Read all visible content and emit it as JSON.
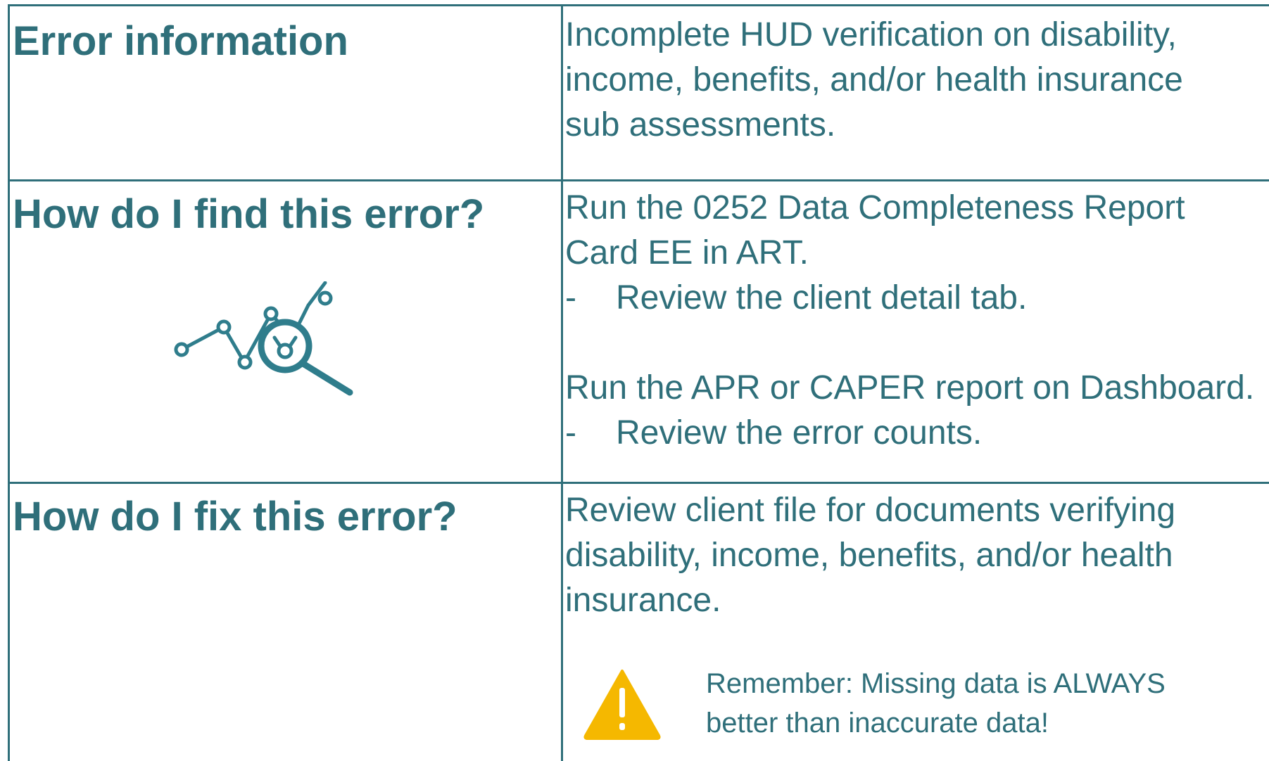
{
  "rows": [
    {
      "heading": "Error information",
      "lines": [
        "Incomplete HUD verification on disability,",
        "income, benefits, and/or health insurance",
        "sub assessments."
      ]
    },
    {
      "heading": "How do I find this error?",
      "lines": [
        "Run the 0252 Data Completeness Report",
        "Card EE in ART."
      ],
      "bullet_1": "Review the client detail tab.",
      "lines_2": [
        "Run the APR or CAPER report on Dashboard."
      ],
      "bullet_2": "Review the error counts.",
      "bullet_marker": "-",
      "icon": "chart-magnifier-icon"
    },
    {
      "heading": "How do I fix this error?",
      "lines": [
        "Review client file for documents verifying",
        "disability, income, benefits, and/or health",
        "insurance."
      ],
      "reminder_lines": [
        "Remember: Missing data is ALWAYS",
        "better than inaccurate data!"
      ],
      "icon": "warning-icon"
    }
  ],
  "colors": {
    "text": "#2f6f7a",
    "border": "#2f6f7a",
    "warning": "#f5b800"
  }
}
